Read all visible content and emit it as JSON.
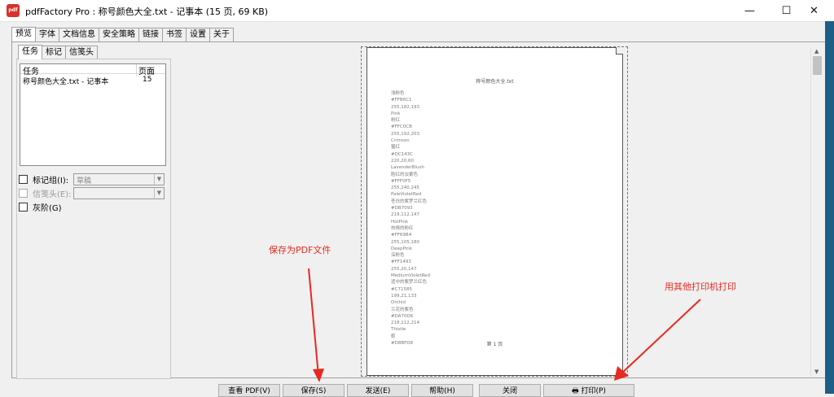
{
  "window": {
    "app_icon_text": "pdf",
    "title": "pdfFactory Pro : 称号颜色大全.txt - 记事本 (15 页, 69 KB)",
    "min_glyph": "—",
    "max_glyph": "☐",
    "close_glyph": "✕"
  },
  "main_tabs": [
    "预览",
    "字体",
    "文档信息",
    "安全策略",
    "链接",
    "书签",
    "设置",
    "关于"
  ],
  "left_panel": {
    "tabs": [
      "任务",
      "标记",
      "信笺头"
    ],
    "task_list": {
      "headers": [
        "任务",
        "页面"
      ],
      "rows": [
        {
          "name": "称号颜色大全.txt - 记事本",
          "pages": "15"
        }
      ]
    },
    "options": {
      "bookmark_group": {
        "label": "标记组(I):",
        "value": "草稿"
      },
      "letterhead": {
        "label": "信笺头(E):",
        "value": ""
      },
      "grayscale": {
        "label": "灰阶(G)"
      }
    }
  },
  "document": {
    "title": "称号颜色大全.txt",
    "lines": [
      "浅粉色",
      "#FFB6C1",
      "255,182,193",
      "Pink",
      "粉红",
      "#FFC0CB",
      "255,192,203",
      "Crimson",
      "猩红",
      "#DC143C",
      "220,20,60",
      "LavenderBlush",
      "脸红的淡紫色",
      "#FFF0F5",
      "255,240,245",
      "PaleVioletRed",
      "苍白的紫罗兰红色",
      "#DB7093",
      "219,112,147",
      "HotPink",
      "热情的粉红",
      "#FF69B4",
      "255,105,180",
      "DeepPink",
      "深粉色",
      "#FF1493",
      "255,20,147",
      "MediumVioletRed",
      "适中的紫罗兰红色",
      "#C71585",
      "199,21,133",
      "Orchid",
      "兰花的紫色",
      "#DA70D6",
      "218,112,214",
      "Thistle",
      "蓟",
      "#D8BFD8"
    ],
    "page_label": "第 1 页"
  },
  "bottom_buttons": [
    "查看 PDF(V)",
    "保存(S)",
    "发送(E)",
    "帮助(H)",
    "关闭",
    "打印(P)"
  ],
  "annotations": {
    "save_pdf": "保存为PDF文件",
    "print_other": "用其他打印机打印"
  }
}
